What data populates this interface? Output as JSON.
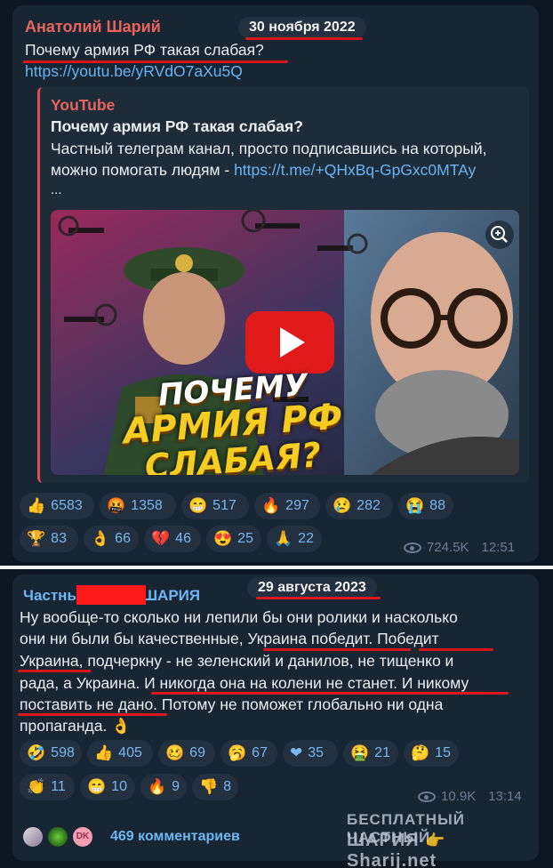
{
  "post1": {
    "author": "Анатолий Шарий",
    "date": "30 ноября 2022",
    "title": "Почему армия РФ такая слабая?",
    "link": "https://youtu.be/yRVdO7aXu5Q",
    "preview": {
      "site": "YouTube",
      "title": "Почему армия РФ такая слабая?",
      "desc_line1": "Частный телеграм канал, просто подписавшись на который,",
      "desc_line2_text": "можно помогать людям - ",
      "desc_line2_link": "https://t.me/+QHxBq-GpGxc0MTAy",
      "ellipsis": "...",
      "thumb_text": [
        "ПОЧЕМУ",
        "АРМИЯ РФ",
        "СЛАБАЯ?"
      ]
    },
    "reactions": [
      {
        "emoji": "👍",
        "count": "6583"
      },
      {
        "emoji": "🤬",
        "count": "1358"
      },
      {
        "emoji": "😁",
        "count": "517"
      },
      {
        "emoji": "🔥",
        "count": "297"
      },
      {
        "emoji": "😢",
        "count": "282"
      },
      {
        "emoji": "😭",
        "count": "88"
      },
      {
        "emoji": "🏆",
        "count": "83"
      },
      {
        "emoji": "👌",
        "count": "66"
      },
      {
        "emoji": "💔",
        "count": "46"
      },
      {
        "emoji": "😍",
        "count": "25"
      },
      {
        "emoji": "🙏",
        "count": "22"
      }
    ],
    "views": "724.5K",
    "time": "12:51"
  },
  "post2": {
    "author_left": "Частны",
    "author_right": "ШАРИЯ",
    "date": "29 августа 2023",
    "lines": [
      "Ну вообще-то сколько ни лепили бы они ролики и насколько",
      "они ни были бы качественные, Украина победит. Победит",
      "Украина, подчеркну - не зеленский и данилов, не тищенко и",
      "рада, а Украина. И никогда она на колени не станет. И никому",
      "поставить не дано. Потому не поможет глобально ни одна",
      "пропаганда. 👌"
    ],
    "reactions": [
      {
        "emoji": "🤣",
        "count": "598"
      },
      {
        "emoji": "👍",
        "count": "405"
      },
      {
        "emoji": "🥴",
        "count": "69"
      },
      {
        "emoji": "🥱",
        "count": "67"
      },
      {
        "emoji": "❤",
        "count": "35"
      },
      {
        "emoji": "🤮",
        "count": "21"
      },
      {
        "emoji": "🤔",
        "count": "15"
      },
      {
        "emoji": "👏",
        "count": "11"
      },
      {
        "emoji": "😁",
        "count": "10"
      },
      {
        "emoji": "🔥",
        "count": "9"
      },
      {
        "emoji": "👎",
        "count": "8"
      }
    ],
    "views": "10.9K",
    "time": "13:14",
    "avatar_dk": "DK",
    "comments": "469 комментариев"
  },
  "watermark": {
    "line1": "БЕСПЛАТНЫЙ ЧАСТНЫЙ",
    "line2a": "ШАРИЯ",
    "line2b": "Sharij.net"
  },
  "colors": {
    "author1": "#e8655e",
    "author2": "#6cb8f5",
    "reaction_text": "#79b8f0",
    "underline": "#d8181e"
  }
}
